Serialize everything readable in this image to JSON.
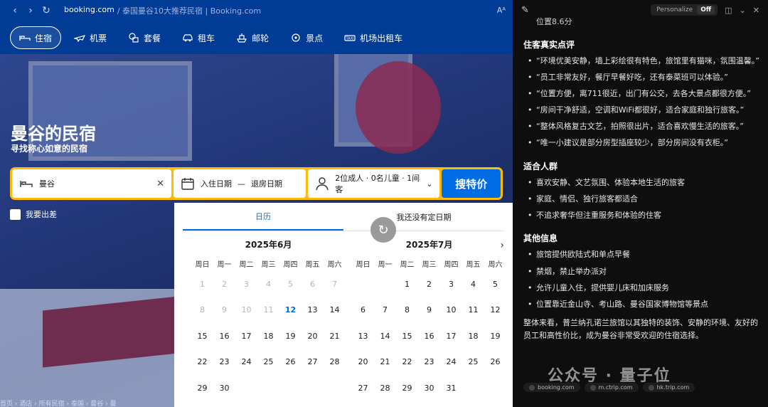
{
  "browser": {
    "url_domain": "booking.com",
    "url_title": "泰国曼谷10大推荐民宿 | Booking.com",
    "text_size_icon": "Aᴬ"
  },
  "nav": {
    "items": [
      {
        "label": "住宿",
        "icon": "bed-icon",
        "active": true
      },
      {
        "label": "机票",
        "icon": "plane-icon"
      },
      {
        "label": "套餐",
        "icon": "package-icon"
      },
      {
        "label": "租车",
        "icon": "car-icon"
      },
      {
        "label": "邮轮",
        "icon": "ship-icon"
      },
      {
        "label": "景点",
        "icon": "attraction-icon"
      },
      {
        "label": "机场出租车",
        "icon": "taxi-icon"
      }
    ]
  },
  "hero": {
    "title": "曼谷的民宿",
    "subtitle": "寻找称心如意的民宿"
  },
  "search": {
    "destination": "曼谷",
    "checkin": "入住日期",
    "dash": "—",
    "checkout": "退房日期",
    "guests": "2位成人 · 0名儿童 · 1间客",
    "button": "搜特价",
    "business": "我要出差"
  },
  "breadcrumb": "首页 › 酒店 › 所有民宿 › 泰国 › 曼谷 › 曼",
  "calendar": {
    "tabs": [
      "日历",
      "我还没有定日期"
    ],
    "weekdays": [
      "周日",
      "周一",
      "周二",
      "周三",
      "周四",
      "周五",
      "周六"
    ],
    "months": [
      {
        "title": "2025年6月",
        "offset": 0,
        "days": 30,
        "today": 12
      },
      {
        "title": "2025年7月",
        "offset": 2,
        "days": 31,
        "today": 0
      }
    ]
  },
  "panel": {
    "personalize": "Personalize",
    "off": "Off",
    "partial_line": "位置8.6分",
    "sections": [
      {
        "heading": "住客真实点评",
        "items": [
          "“环境优美安静，墙上彩绘很有特色，旅馆里有猫咪，氛围温馨。”",
          "“员工非常友好，餐厅早餐好吃，还有泰菜班可以体验。”",
          "“位置方便，离711很近，出门有公交，去各大景点都很方便。”",
          "“房间干净舒适，空调和WiFi都很好，适合家庭和独行旅客。”",
          "“整体风格复古文艺，拍照很出片，适合喜欢慢生活的旅客。”",
          "“唯一小建议是部分房型插座较少，部分房间没有衣柜。”"
        ]
      },
      {
        "heading": "适合人群",
        "items": [
          "喜欢安静、文艺氛围、体验本地生活的旅客",
          "家庭、情侣、独行旅客都适合",
          "不追求奢华但注重服务和体验的住客"
        ]
      },
      {
        "heading": "其他信息",
        "items": [
          "旅馆提供欧陆式和单点早餐",
          "禁烟，禁止举办派对",
          "允许儿童入住，提供婴儿床和加床服务",
          "位置靠近金山寺、考山路、曼谷国家博物馆等景点"
        ]
      }
    ],
    "summary": "整体来看，普兰纳孔诺兰旅馆以其独特的装饰、安静的环境、友好的员工和高性价比，成为曼谷非常受欢迎的住宿选择。",
    "sources": [
      "booking.com",
      "m.ctrip.com",
      "hk.trip.com"
    ],
    "watermark": "公众号 · 量子位"
  }
}
